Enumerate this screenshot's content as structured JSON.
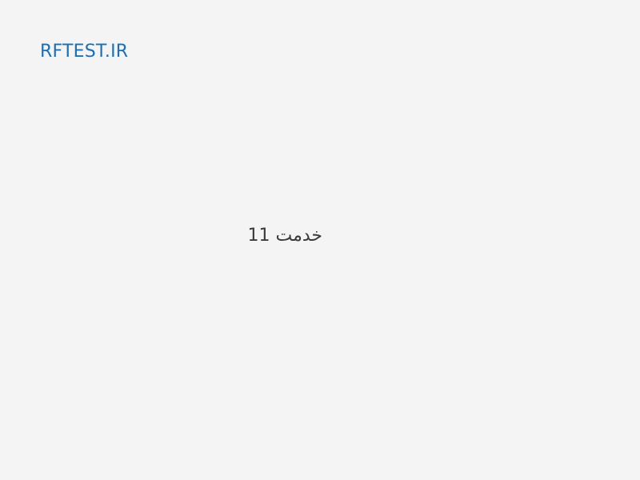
{
  "header": {
    "logo_text": "RFTEST.IR"
  },
  "main": {
    "service_title": "خدمت 11"
  },
  "colors": {
    "background": "#f4f4f4",
    "logo": "#1a6fb5",
    "text": "#3a3a3a"
  }
}
